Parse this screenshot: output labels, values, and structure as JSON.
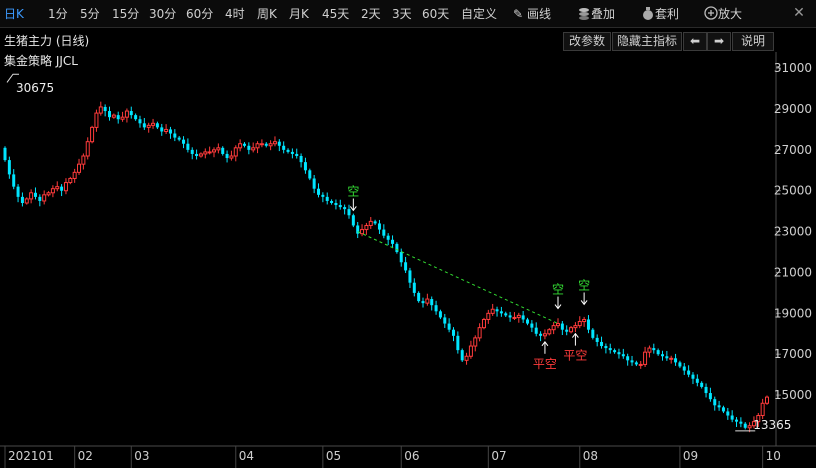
{
  "toolbar": {
    "items": [
      "日K",
      "1分",
      "5分",
      "15分",
      "30分",
      "60分",
      "4时",
      "周K",
      "月K",
      "45天",
      "2天",
      "3天",
      "60天",
      "自定义"
    ],
    "active_index": 0,
    "draw_label": "画线",
    "overlay_label": "叠加",
    "arbitrage_label": "套利",
    "zoom_label": "放大",
    "close_glyph": "✕"
  },
  "header": {
    "title": "生猪主力 (日线)",
    "buttons": {
      "params": "改参数",
      "hide": "隐藏主指标",
      "prev": "⬅",
      "next": "➡",
      "help": "说明"
    }
  },
  "indicator_label": "集金策略 JJCL",
  "colors": {
    "up": "#ff3b3b",
    "down": "#00e5ff",
    "signal_short": "#33dd33",
    "signal_cover": "#ff3b3b",
    "trend_line": "#33dd33"
  },
  "chart_data": {
    "type": "candlestick",
    "y_ticks": [
      31000,
      29000,
      27000,
      25000,
      23000,
      21000,
      19000,
      17000,
      15000
    ],
    "ylim": [
      12900,
      31300
    ],
    "x_labels": [
      {
        "label": "202101",
        "index": 0
      },
      {
        "label": "02",
        "index": 16
      },
      {
        "label": "03",
        "index": 29
      },
      {
        "label": "04",
        "index": 53
      },
      {
        "label": "05",
        "index": 73
      },
      {
        "label": "06",
        "index": 91
      },
      {
        "label": "07",
        "index": 111
      },
      {
        "label": "08",
        "index": 132
      },
      {
        "label": "09",
        "index": 155
      },
      {
        "label": "10",
        "index": 174
      }
    ],
    "closes": [
      26500,
      25800,
      25200,
      24700,
      24400,
      24600,
      24900,
      24700,
      24500,
      24800,
      24900,
      25100,
      25200,
      25000,
      25400,
      25600,
      25900,
      26300,
      26700,
      27400,
      28100,
      28800,
      29100,
      28900,
      28600,
      28700,
      28500,
      28600,
      28900,
      28700,
      28500,
      28300,
      28100,
      28200,
      28300,
      28100,
      27900,
      28000,
      27800,
      27600,
      27500,
      27300,
      27000,
      26800,
      26700,
      26800,
      26900,
      26900,
      27000,
      27100,
      26800,
      26600,
      26700,
      27100,
      27300,
      27200,
      27000,
      27100,
      27300,
      27300,
      27200,
      27300,
      27400,
      27200,
      27000,
      26900,
      26800,
      26700,
      26400,
      26000,
      25600,
      25100,
      24800,
      24700,
      24500,
      24400,
      24300,
      24200,
      24100,
      23800,
      23300,
      22900,
      23100,
      23300,
      23500,
      23400,
      23100,
      22800,
      22600,
      22400,
      22000,
      21500,
      21100,
      20500,
      20000,
      19600,
      19500,
      19700,
      19400,
      19100,
      18800,
      18500,
      18200,
      17900,
      17200,
      16700,
      16900,
      17400,
      17800,
      18300,
      18700,
      19000,
      19200,
      19100,
      19000,
      18900,
      18800,
      18800,
      18900,
      18700,
      18500,
      18300,
      18000,
      17900,
      18000,
      18200,
      18400,
      18500,
      18200,
      18100,
      18300,
      18400,
      18600,
      18700,
      18200,
      17800,
      17600,
      17400,
      17300,
      17200,
      17100,
      17000,
      16900,
      16700,
      16600,
      16500,
      16500,
      17100,
      17300,
      17200,
      17000,
      16900,
      16800,
      16800,
      16600,
      16400,
      16200,
      16000,
      15800,
      15600,
      15400,
      15100,
      14800,
      14500,
      14400,
      14200,
      14000,
      13800,
      13700,
      13600,
      13400,
      13500,
      13700,
      14000,
      14600,
      14900
    ],
    "max_label": "30675",
    "min_label": "13365",
    "signals": [
      {
        "type": "short",
        "label": "空",
        "index": 80
      },
      {
        "type": "short",
        "label": "空",
        "index": 127
      },
      {
        "type": "short",
        "label": "空",
        "index": 133
      },
      {
        "type": "cover",
        "label": "平空",
        "index": 124
      },
      {
        "type": "cover",
        "label": "平空",
        "index": 131
      }
    ],
    "trend_line": {
      "from_index": 81,
      "from_value": 23000,
      "to_index": 127,
      "to_value": 18500
    }
  }
}
